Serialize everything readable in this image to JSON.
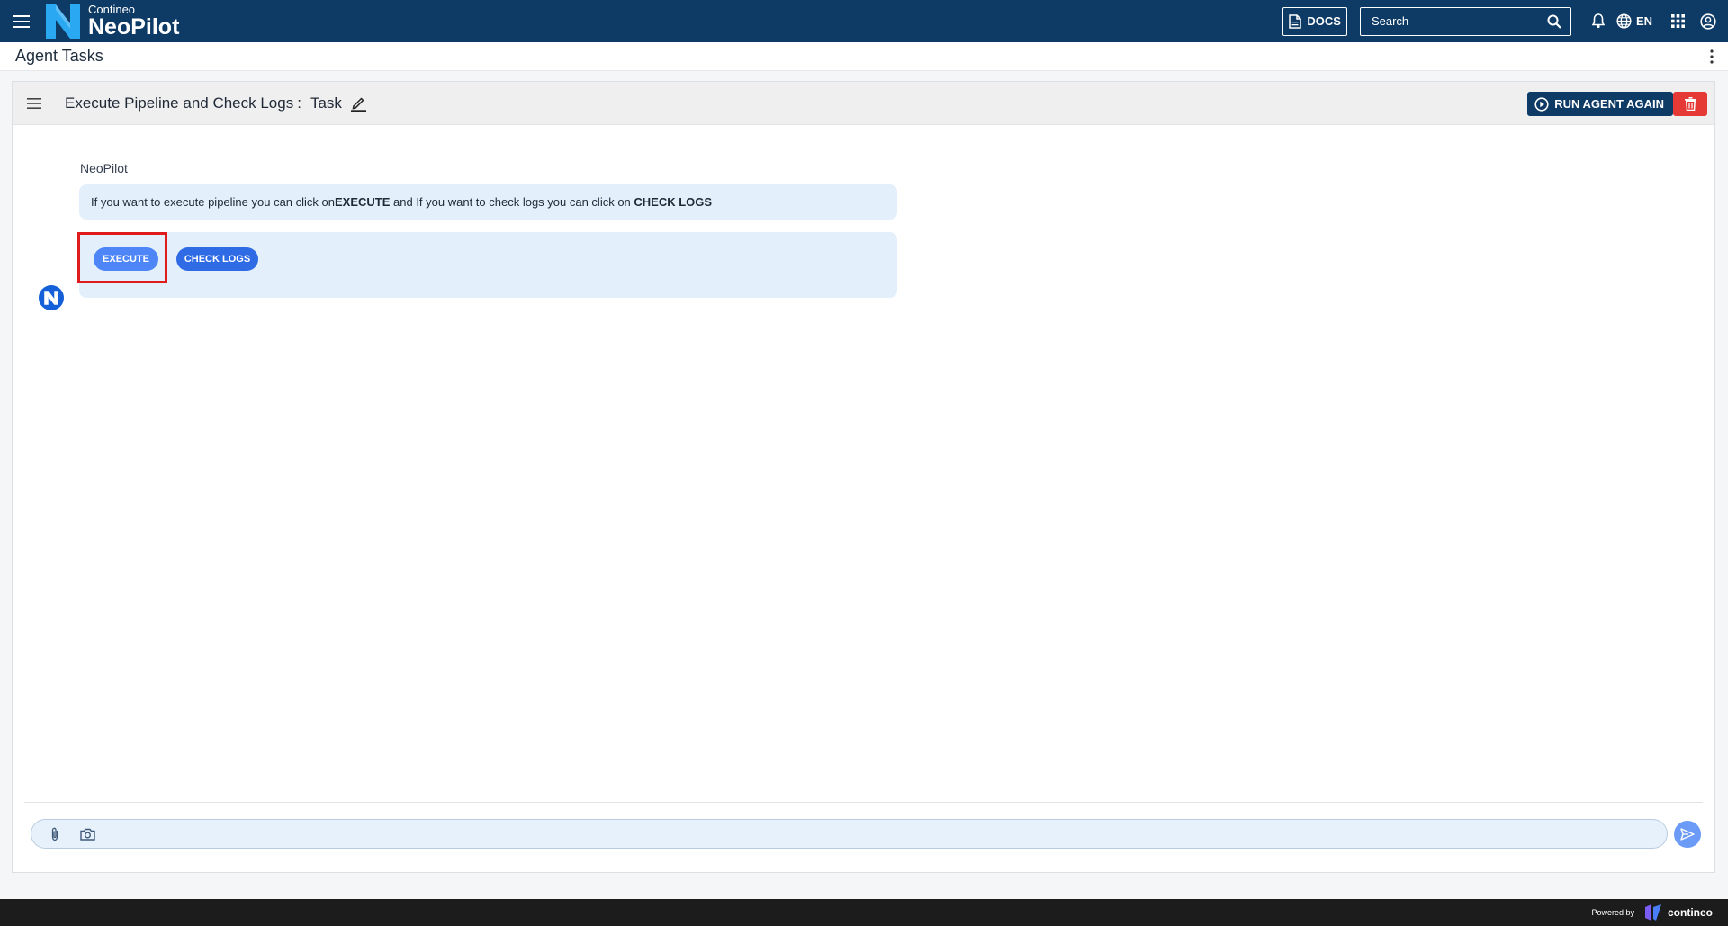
{
  "header": {
    "brand_small": "Contineo",
    "brand_big": "NeoPilot",
    "docs_label": "DOCS",
    "search_placeholder": "Search",
    "language": "EN"
  },
  "page": {
    "title": "Agent Tasks"
  },
  "task": {
    "title": "Execute Pipeline and Check Logs",
    "separator": ":",
    "name": "Task",
    "run_again_label": "RUN AGENT AGAIN"
  },
  "chat": {
    "sender": "NeoPilot",
    "message_parts": {
      "p1": "If you want to execute pipeline you can click on ",
      "b1": "EXECUTE",
      "p2": " and If you want to check logs you can click on ",
      "b2": "CHECK LOGS"
    },
    "actions": {
      "execute_label": "EXECUTE",
      "check_logs_label": "CHECK LOGS"
    }
  },
  "composer": {
    "input_value": ""
  },
  "footer": {
    "powered_by": "Powered by",
    "company": "contineo"
  },
  "colors": {
    "topbar": "#0e3a66",
    "accent": "#3b7bf0",
    "danger": "#e53935",
    "bubble": "#e3f0fb"
  }
}
